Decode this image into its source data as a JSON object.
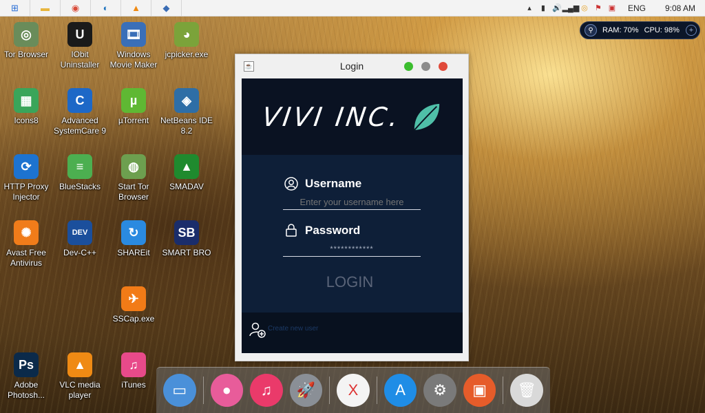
{
  "taskbar": {
    "apps": [
      {
        "name": "windows-icon",
        "glyph": "⊞",
        "color": "#2a6fd6"
      },
      {
        "name": "file-explorer-icon",
        "glyph": "▬",
        "color": "#e7b53d"
      },
      {
        "name": "chrome-icon",
        "glyph": "◉",
        "color": "#d94a38"
      },
      {
        "name": "ccleaner-icon",
        "glyph": "◐",
        "color": "#1e73be"
      },
      {
        "name": "vlc-icon",
        "glyph": "▲",
        "color": "#ef8a14"
      },
      {
        "name": "virtualbox-icon",
        "glyph": "◆",
        "color": "#3b6cb4"
      }
    ],
    "language": "ENG",
    "time": "9:08 AM"
  },
  "monitor": {
    "ram": "RAM: 70%",
    "cpu": "CPU: 98%"
  },
  "desktop_icons": [
    {
      "label": "Tor Browser",
      "icon": "tor-browser-icon",
      "glyph": "◎",
      "color": "#6a8c5a"
    },
    {
      "label": "IObit Uninstaller",
      "icon": "iobit-uninstaller-icon",
      "glyph": "U",
      "color": "#1a1a1a"
    },
    {
      "label": "Windows Movie Maker",
      "icon": "movie-maker-icon",
      "glyph": "🎞",
      "color": "#3a6fb8"
    },
    {
      "label": "jcpicker.exe",
      "icon": "jcpicker-icon",
      "glyph": "◕",
      "color": "#7ba33a"
    },
    {
      "label": "Icons8",
      "icon": "icons8-icon",
      "glyph": "▦",
      "color": "#3aa55a"
    },
    {
      "label": "Advanced SystemCare 9",
      "icon": "advanced-systemcare-icon",
      "glyph": "C",
      "color": "#1d68c7"
    },
    {
      "label": "µTorrent",
      "icon": "utorrent-icon",
      "glyph": "µ",
      "color": "#5fb833"
    },
    {
      "label": "NetBeans IDE 8.2",
      "icon": "netbeans-icon",
      "glyph": "◈",
      "color": "#2e6ea6"
    },
    {
      "label": "HTTP Proxy Injector",
      "icon": "http-proxy-injector-icon",
      "glyph": "⟳",
      "color": "#1d73d0"
    },
    {
      "label": "BlueStacks",
      "icon": "bluestacks-icon",
      "glyph": "≡",
      "color": "#4caf50"
    },
    {
      "label": "Start Tor Browser",
      "icon": "start-tor-browser-icon",
      "glyph": "◍",
      "color": "#6d9f4f"
    },
    {
      "label": "SMADAV",
      "icon": "smadav-icon",
      "glyph": "▲",
      "color": "#1f8a2e"
    },
    {
      "label": "Avast Free Antivirus",
      "icon": "avast-icon",
      "glyph": "✺",
      "color": "#f07c1a"
    },
    {
      "label": "Dev-C++",
      "icon": "devcpp-icon",
      "glyph": "DEV",
      "color": "#1b4f9c"
    },
    {
      "label": "SHAREit",
      "icon": "shareit-icon",
      "glyph": "↻",
      "color": "#2a8ae0"
    },
    {
      "label": "SMART BRO",
      "icon": "smart-bro-icon",
      "glyph": "SB",
      "color": "#1a2d6b"
    },
    {
      "label": "SSCap.exe",
      "icon": "sscap-icon",
      "glyph": "✈",
      "color": "#f27b17"
    },
    {
      "label": "Adobe Photosh...",
      "icon": "photoshop-icon",
      "glyph": "Ps",
      "color": "#0b2a4a"
    },
    {
      "label": "VLC media player",
      "icon": "vlc-media-player-icon",
      "glyph": "▲",
      "color": "#ef8a14"
    },
    {
      "label": "iTunes",
      "icon": "itunes-icon",
      "glyph": "♫",
      "color": "#e84a8a"
    }
  ],
  "login": {
    "window_title": "Login",
    "brand": "VIVI INC.",
    "username_label": "Username",
    "username_placeholder": "Enter your username here",
    "password_label": "Password",
    "password_value": "************",
    "login_button": "LOGIN",
    "create_user": "Create new user"
  },
  "dock": [
    {
      "name": "imac-icon",
      "glyph": "▭",
      "color": "#4a90d9"
    },
    {
      "name": "game-center-icon",
      "glyph": "●",
      "color": "#e85c9a"
    },
    {
      "name": "itunes-dock-icon",
      "glyph": "♫",
      "color": "#ea3a6a"
    },
    {
      "name": "launchpad-icon",
      "glyph": "🚀",
      "color": "#8a8f96"
    },
    {
      "name": "mac-os-x-icon",
      "glyph": "X",
      "color": "#f4f4f4"
    },
    {
      "name": "app-store-icon",
      "glyph": "A",
      "color": "#1f8de6"
    },
    {
      "name": "system-preferences-icon",
      "glyph": "⚙",
      "color": "#7a7a7a"
    },
    {
      "name": "dashboard-icon",
      "glyph": "▣",
      "color": "#e65c2a"
    },
    {
      "name": "trash-icon",
      "glyph": "🗑",
      "color": "#d9d9d9"
    }
  ]
}
